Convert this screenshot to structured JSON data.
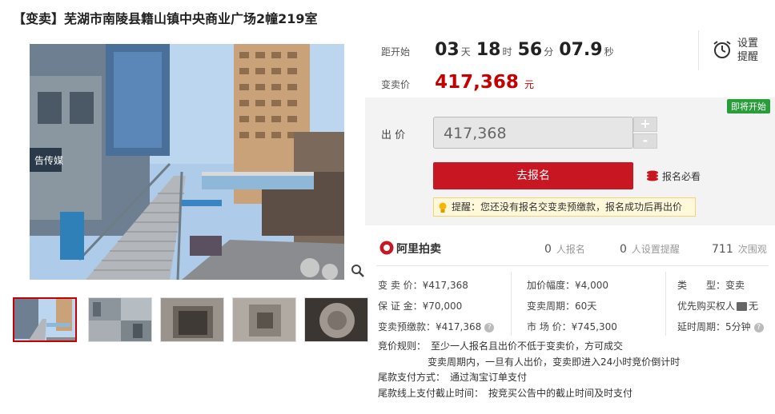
{
  "page": {
    "title": "【变卖】芜湖市南陵县籍山镇中央商业广场2幢219室"
  },
  "gallery": {
    "zoom_icon": "magnifier-icon",
    "thumbnail_count": 5
  },
  "timer": {
    "label": "距开始",
    "days": "03",
    "days_unit": "天",
    "hours": "18",
    "hours_unit": "时",
    "minutes": "56",
    "minutes_unit": "分",
    "seconds": "07.9",
    "seconds_unit": "秒"
  },
  "reminder": {
    "icon": "alarm-clock-icon",
    "label": "设置提醒"
  },
  "price": {
    "label": "变卖价",
    "value": "417,368",
    "unit": "元"
  },
  "bid": {
    "status_badge": "即将开始",
    "label": "出 价",
    "value": "417,368",
    "plus": "+",
    "minus": "-",
    "signup_button": "去报名",
    "must_read": "报名必看",
    "tip": "提醒：您还没有报名交变卖预缴款，报名成功后再出价"
  },
  "stats": {
    "logo": "阿里拍卖",
    "registered_count": "0",
    "registered_label": "人报名",
    "reminder_count": "0",
    "reminder_label": "人设置提醒",
    "views_count": "711",
    "views_label": "次围观"
  },
  "info": {
    "col1": [
      {
        "label": "变 卖 价：",
        "value": "¥417,368"
      },
      {
        "label": "保 证 金：",
        "value": "¥70,000"
      },
      {
        "label": "变卖预缴款：",
        "value": "¥417,368"
      }
    ],
    "col2": [
      {
        "label": "加价幅度：",
        "value": "¥4,000"
      },
      {
        "label": "变卖周期：",
        "value": "60天"
      },
      {
        "label": "市 场 价：",
        "value": "¥745,300"
      }
    ],
    "col3": [
      {
        "label": "类　　型：",
        "value": "变卖"
      },
      {
        "label": "优先购买权人",
        "value": "无"
      },
      {
        "label": "延时周期：",
        "value": "5分钟"
      }
    ]
  },
  "rules": {
    "line1_label": "竞价规则：",
    "line1": "至少一人报名且出价不低于变卖价，方可成交",
    "line2": "变卖周期内，一旦有人出价，变卖即进入24小时竞价倒计时",
    "line3_label": "尾款支付方式：",
    "line3": "通过淘宝订单支付",
    "line4_label": "尾款线上支付截止时间：",
    "line4": "按竞买公告中的截止时间及时支付"
  },
  "colors": {
    "accent_red": "#c40000",
    "button_red": "#c81623",
    "badge_green": "#2a9d3b",
    "tip_bg": "#fff8d9"
  }
}
